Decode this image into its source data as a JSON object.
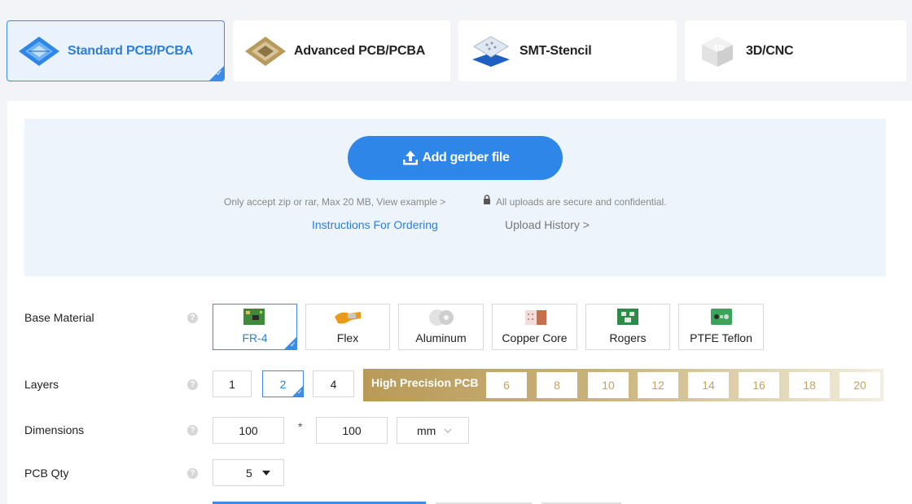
{
  "tabs": [
    {
      "label": "Standard PCB/PCBA",
      "active": true,
      "icon": "standard-pcb-icon"
    },
    {
      "label": "Advanced PCB/PCBA",
      "active": false,
      "icon": "advanced-pcb-icon"
    },
    {
      "label": "SMT-Stencil",
      "active": false,
      "icon": "smt-stencil-icon"
    },
    {
      "label": "3D/CNC",
      "active": false,
      "icon": "3d-cnc-icon"
    }
  ],
  "upload": {
    "button_label": "Add gerber file",
    "hint": "Only accept zip or rar, Max 20 MB, View example >",
    "secure": "All uploads are secure and confidential.",
    "instructions_link": "Instructions For Ordering",
    "history_link": "Upload History >"
  },
  "form": {
    "base_material": {
      "label": "Base Material",
      "options": [
        {
          "label": "FR-4",
          "selected": true
        },
        {
          "label": "Flex",
          "selected": false
        },
        {
          "label": "Aluminum",
          "selected": false
        },
        {
          "label": "Copper Core",
          "selected": false
        },
        {
          "label": "Rogers",
          "selected": false
        },
        {
          "label": "PTFE Teflon",
          "selected": false
        }
      ]
    },
    "layers": {
      "label": "Layers",
      "options": [
        "1",
        "2",
        "4"
      ],
      "selected": "2",
      "high_precision_label": "High Precision PCB",
      "high_precision_options": [
        "6",
        "8",
        "10",
        "12",
        "14",
        "16",
        "18",
        "20"
      ]
    },
    "dimensions": {
      "label": "Dimensions",
      "width": "100",
      "separator": "*",
      "height": "100",
      "unit": "mm"
    },
    "pcb_qty": {
      "label": "PCB Qty",
      "value": "5"
    },
    "help_glyph": "?"
  },
  "colors": {
    "accent": "#2e87e8",
    "gold": "#c7a15e"
  }
}
